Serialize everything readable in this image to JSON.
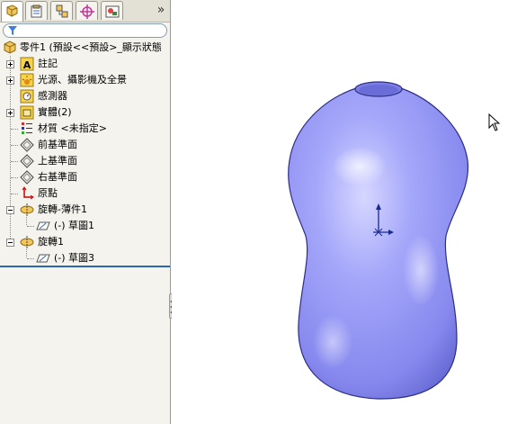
{
  "feature_manager": {
    "tabs": [
      {
        "name": "feature-manager-tab",
        "icon": "feature-tree-icon",
        "active": true
      },
      {
        "name": "property-manager-tab",
        "icon": "property-manager-icon"
      },
      {
        "name": "configuration-manager-tab",
        "icon": "configuration-manager-icon"
      },
      {
        "name": "dimxpert-manager-tab",
        "icon": "dimxpert-icon"
      },
      {
        "name": "display-manager-tab",
        "icon": "display-manager-icon"
      }
    ],
    "more_tabs": "»",
    "tree": {
      "root_label": "零件1  (預設<<預設>_顯示狀態",
      "items": [
        {
          "label": "註記",
          "icon": "annotations-icon"
        },
        {
          "label": "光源、攝影機及全景",
          "icon": "lights-cameras-icon"
        },
        {
          "label": "感測器",
          "icon": "sensors-icon"
        },
        {
          "label": "實體(2)",
          "icon": "solid-bodies-icon"
        },
        {
          "label": "材質 <未指定>",
          "icon": "material-icon"
        },
        {
          "label": "前基準面",
          "icon": "plane-icon"
        },
        {
          "label": "上基準面",
          "icon": "plane-icon"
        },
        {
          "label": "右基準面",
          "icon": "plane-icon"
        },
        {
          "label": "原點",
          "icon": "origin-icon"
        },
        {
          "label": "旋轉-薄件1",
          "icon": "revolve-icon"
        },
        {
          "label": "(-) 草圖1",
          "icon": "sketch-icon"
        },
        {
          "label": "旋轉1",
          "icon": "revolve-icon"
        },
        {
          "label": "(-) 草圖3",
          "icon": "sketch-icon"
        }
      ]
    }
  },
  "viewport": {
    "model": "revolved-vase-body",
    "body_color": "#8e90f2",
    "triad": "origin-triad"
  },
  "colors": {
    "selection_line": "#2c65b0",
    "panel_bg": "#f4f3ee"
  }
}
